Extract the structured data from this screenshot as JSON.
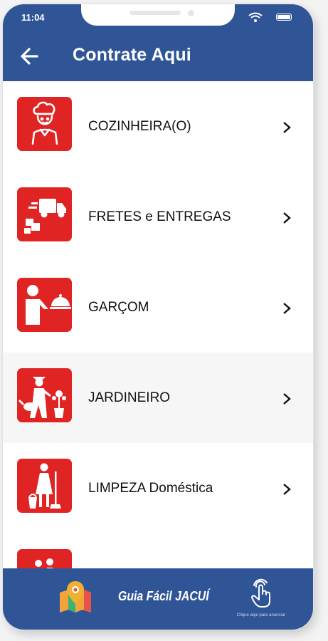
{
  "status": {
    "time": "11:04"
  },
  "header": {
    "title": "Contrate Aqui"
  },
  "items": [
    {
      "label": "COZINHEIRA(O)",
      "icon": "chef-icon"
    },
    {
      "label": "FRETES e ENTREGAS",
      "icon": "delivery-truck-icon"
    },
    {
      "label": "GARÇOM",
      "icon": "waiter-icon"
    },
    {
      "label": "JARDINEIRO",
      "icon": "gardener-icon"
    },
    {
      "label": "LIMPEZA Doméstica",
      "icon": "housekeeper-icon"
    }
  ],
  "footer": {
    "brand": "Guia Fácil JACUÍ",
    "advertise": "Clique aqui para anunciar"
  },
  "colors": {
    "header": "#2f5597",
    "tile": "#e02424"
  }
}
